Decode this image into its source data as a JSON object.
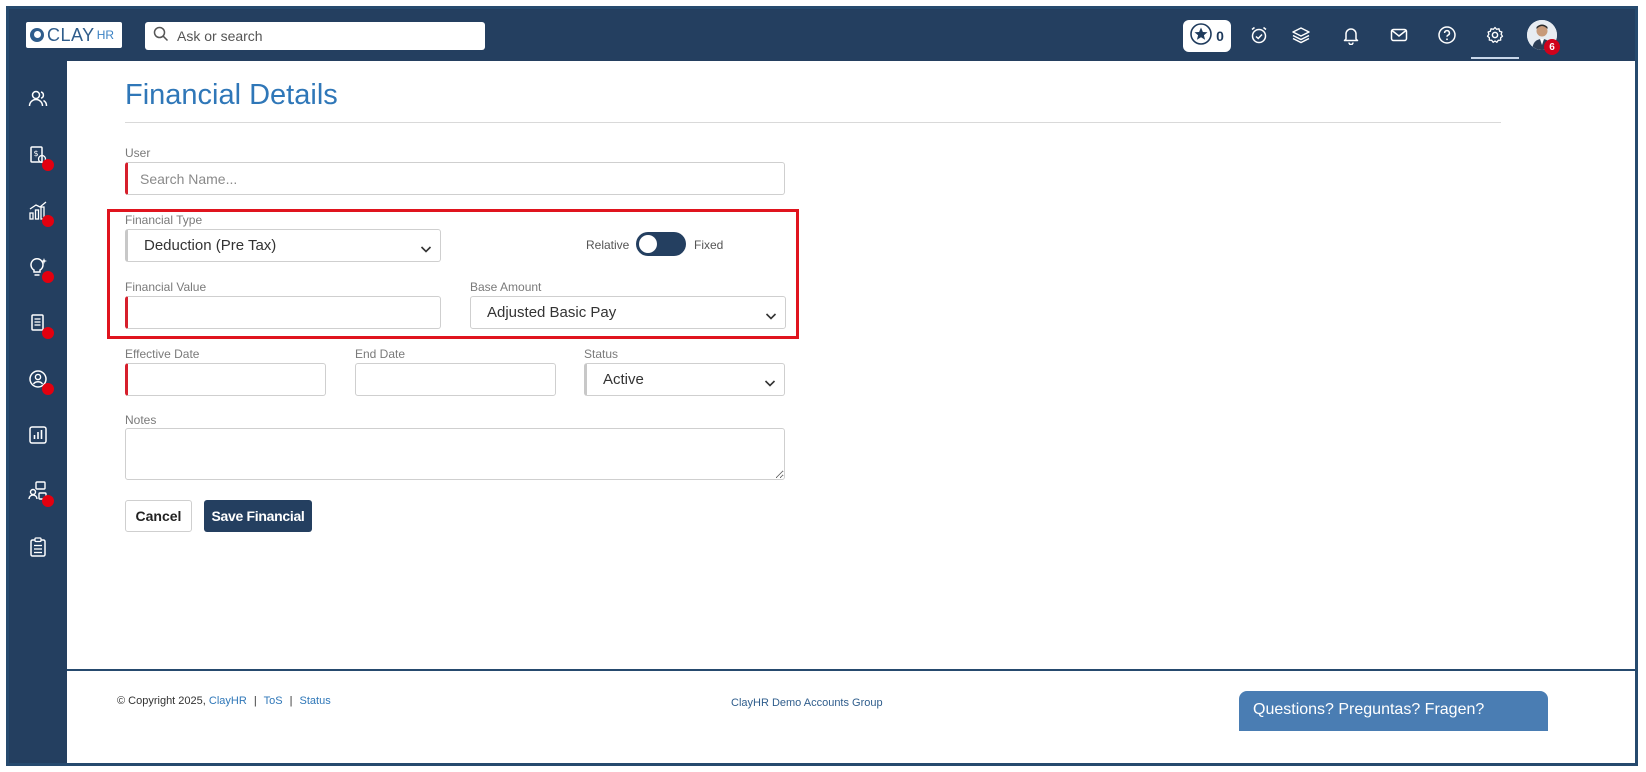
{
  "app": {
    "logo_text": "CLAY",
    "logo_sub": "HR"
  },
  "search": {
    "placeholder": "Ask or search"
  },
  "topbar": {
    "star_count": "0",
    "notification_count": "6",
    "icons": [
      "star-icon",
      "alarm-clock-icon",
      "layers-icon",
      "bell-icon",
      "mail-icon",
      "help-icon",
      "gear-icon",
      "avatar"
    ]
  },
  "sidebar": {
    "items": [
      {
        "icon": "users-icon",
        "badge": false
      },
      {
        "icon": "payroll-icon",
        "badge": true
      },
      {
        "icon": "performance-chart-icon",
        "badge": true
      },
      {
        "icon": "lightbulb-icon",
        "badge": true
      },
      {
        "icon": "documents-icon",
        "badge": true
      },
      {
        "icon": "profile-circle-icon",
        "badge": true
      },
      {
        "icon": "reports-icon",
        "badge": false
      },
      {
        "icon": "org-chart-icon",
        "badge": true
      },
      {
        "icon": "checklist-icon",
        "badge": false
      }
    ]
  },
  "page": {
    "title": "Financial Details"
  },
  "form": {
    "user_label": "User",
    "user_placeholder": "Search Name...",
    "financial_type_label": "Financial Type",
    "financial_type_value": "Deduction (Pre Tax)",
    "toggle_left": "Relative",
    "toggle_right": "Fixed",
    "financial_value_label": "Financial Value",
    "financial_value": "",
    "base_amount_label": "Base Amount",
    "base_amount_value": "Adjusted Basic Pay",
    "effective_date_label": "Effective Date",
    "end_date_label": "End Date",
    "status_label": "Status",
    "status_value": "Active",
    "notes_label": "Notes",
    "cancel_label": "Cancel",
    "save_label": "Save Financial"
  },
  "footer": {
    "copyright_prefix": "© Copyright 2025,",
    "brand_link": "ClayHR",
    "tos_link": "ToS",
    "status_link": "Status",
    "group_name": "ClayHR Demo Accounts Group",
    "chat_text": "Questions? Preguntas? Fragen?"
  },
  "colors": {
    "navy": "#243f60",
    "title_blue": "#2f77b8",
    "required_red": "#d61f2c",
    "highlight_red": "#e0141e",
    "badge_red": "#e3000f",
    "chat_blue": "#4a7db3"
  }
}
